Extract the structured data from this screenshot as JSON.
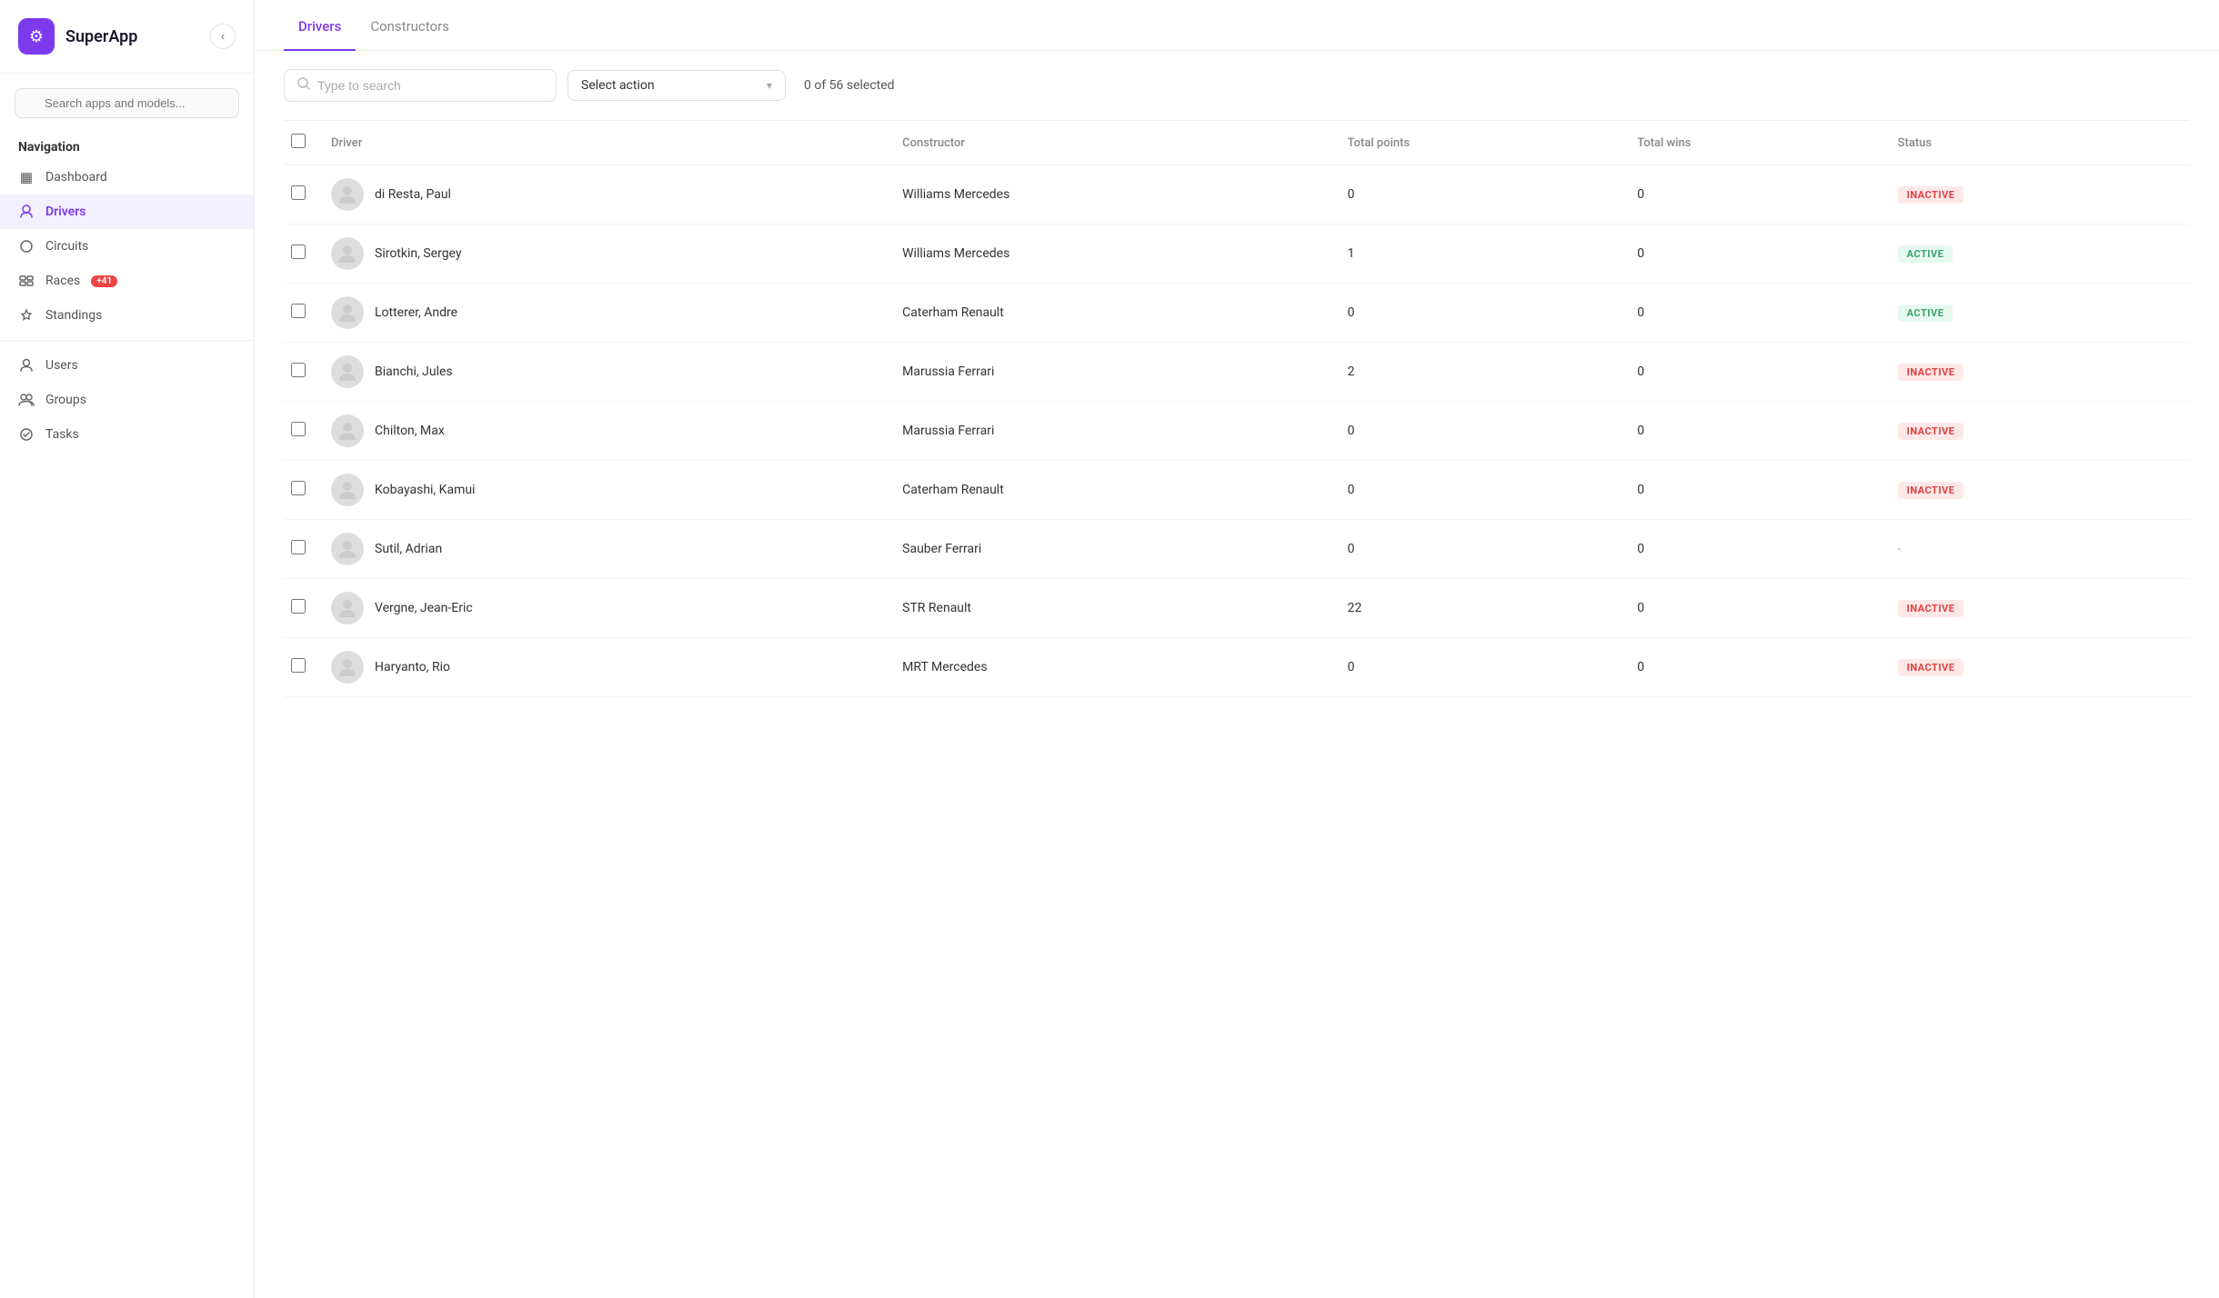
{
  "app": {
    "title": "SuperApp",
    "logo_icon": "⚙"
  },
  "sidebar": {
    "search_placeholder": "Search apps and models...",
    "nav_label": "Navigation",
    "collapse_icon": "‹",
    "items": [
      {
        "id": "dashboard",
        "label": "Dashboard",
        "icon": "▦",
        "active": false,
        "badge": null
      },
      {
        "id": "drivers",
        "label": "Drivers",
        "icon": "○",
        "active": true,
        "badge": null
      },
      {
        "id": "circuits",
        "label": "Circuits",
        "icon": "◎",
        "active": false,
        "badge": null
      },
      {
        "id": "races",
        "label": "Races",
        "icon": "⊞",
        "active": false,
        "badge": "+41"
      },
      {
        "id": "standings",
        "label": "Standings",
        "icon": "☆",
        "active": false,
        "badge": null
      },
      {
        "id": "users",
        "label": "Users",
        "icon": "👤",
        "active": false,
        "badge": null
      },
      {
        "id": "groups",
        "label": "Groups",
        "icon": "👥",
        "active": false,
        "badge": null
      },
      {
        "id": "tasks",
        "label": "Tasks",
        "icon": "✓",
        "active": false,
        "badge": null
      }
    ]
  },
  "tabs": [
    {
      "id": "drivers",
      "label": "Drivers",
      "active": true
    },
    {
      "id": "constructors",
      "label": "Constructors",
      "active": false
    }
  ],
  "toolbar": {
    "search_placeholder": "Type to search",
    "action_label": "Select action",
    "selection_text": "0 of 56 selected",
    "search_icon": "🔍"
  },
  "table": {
    "columns": [
      {
        "id": "checkbox",
        "label": ""
      },
      {
        "id": "driver",
        "label": "Driver"
      },
      {
        "id": "constructor",
        "label": "Constructor"
      },
      {
        "id": "total_points",
        "label": "Total points"
      },
      {
        "id": "total_wins",
        "label": "Total wins"
      },
      {
        "id": "status",
        "label": "Status"
      }
    ],
    "rows": [
      {
        "id": 1,
        "driver": "di Resta, Paul",
        "constructor": "Williams Mercedes",
        "total_points": "0",
        "total_wins": "0",
        "status": "INACTIVE"
      },
      {
        "id": 2,
        "driver": "Sirotkin, Sergey",
        "constructor": "Williams Mercedes",
        "total_points": "1",
        "total_wins": "0",
        "status": "ACTIVE"
      },
      {
        "id": 3,
        "driver": "Lotterer, Andre",
        "constructor": "Caterham Renault",
        "total_points": "0",
        "total_wins": "0",
        "status": "ACTIVE"
      },
      {
        "id": 4,
        "driver": "Bianchi, Jules",
        "constructor": "Marussia Ferrari",
        "total_points": "2",
        "total_wins": "0",
        "status": "INACTIVE"
      },
      {
        "id": 5,
        "driver": "Chilton, Max",
        "constructor": "Marussia Ferrari",
        "total_points": "0",
        "total_wins": "0",
        "status": "INACTIVE"
      },
      {
        "id": 6,
        "driver": "Kobayashi, Kamui",
        "constructor": "Caterham Renault",
        "total_points": "0",
        "total_wins": "0",
        "status": "INACTIVE"
      },
      {
        "id": 7,
        "driver": "Sutil, Adrian",
        "constructor": "Sauber Ferrari",
        "total_points": "0",
        "total_wins": "0",
        "status": "-"
      },
      {
        "id": 8,
        "driver": "Vergne, Jean-Eric",
        "constructor": "STR Renault",
        "total_points": "22",
        "total_wins": "0",
        "status": "INACTIVE"
      },
      {
        "id": 9,
        "driver": "Haryanto, Rio",
        "constructor": "MRT Mercedes",
        "total_points": "0",
        "total_wins": "0",
        "status": "INACTIVE"
      }
    ]
  },
  "colors": {
    "brand": "#7c3aed",
    "active_nav_bg": "#f3f0ff",
    "inactive_badge_bg": "#fde8e8",
    "inactive_badge_text": "#e53e3e",
    "active_badge_bg": "#e6f9f0",
    "active_badge_text": "#38a169"
  }
}
